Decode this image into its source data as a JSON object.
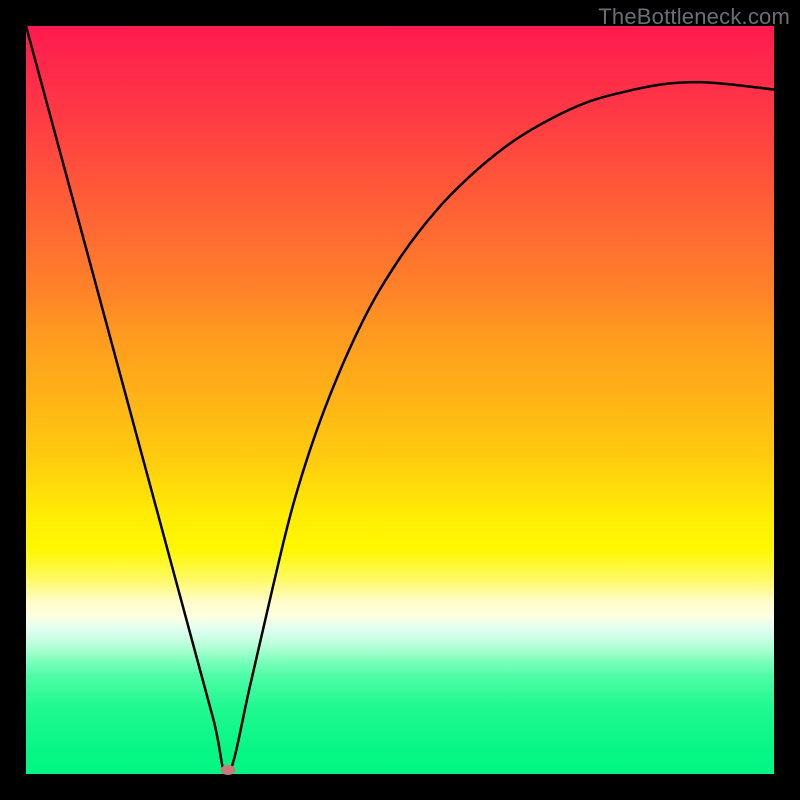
{
  "watermark": "TheBottleneck.com",
  "chart_data": {
    "type": "line",
    "title": "",
    "xlabel": "",
    "ylabel": "",
    "x": [
      0.0,
      0.05,
      0.1,
      0.15,
      0.2,
      0.25,
      0.27,
      0.3,
      0.33,
      0.36,
      0.4,
      0.45,
      0.5,
      0.55,
      0.6,
      0.65,
      0.7,
      0.75,
      0.8,
      0.85,
      0.9,
      0.95,
      1.0
    ],
    "values": [
      1.0,
      0.815,
      0.63,
      0.445,
      0.26,
      0.075,
      0.0,
      0.12,
      0.25,
      0.37,
      0.49,
      0.605,
      0.69,
      0.755,
      0.805,
      0.845,
      0.875,
      0.898,
      0.912,
      0.922,
      0.925,
      0.921,
      0.915
    ],
    "ylim": [
      0,
      1
    ],
    "xlim": [
      0,
      1
    ],
    "marker": {
      "x": 0.27,
      "y": 0.005
    },
    "background_gradient": {
      "top": "#ff1a50",
      "mid": "#ffde08",
      "bottom": "#02f682"
    }
  }
}
